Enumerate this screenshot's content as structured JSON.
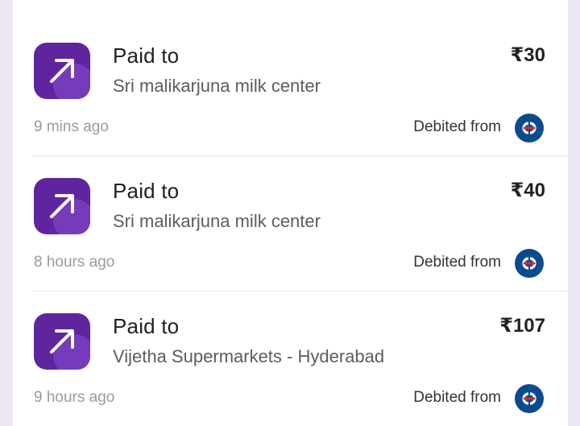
{
  "transactions": [
    {
      "title": "Paid to",
      "merchant": "Sri malikarjuna milk center",
      "amount": "₹30",
      "time": "9 mins ago",
      "debited_label": "Debited from"
    },
    {
      "title": "Paid to",
      "merchant": "Sri malikarjuna milk center",
      "amount": "₹40",
      "time": "8 hours ago",
      "debited_label": "Debited from"
    },
    {
      "title": "Paid to",
      "merchant": "Vijetha Supermarkets - Hyderabad",
      "amount": "₹107",
      "time": "9 hours ago",
      "debited_label": "Debited from"
    }
  ],
  "icons": {
    "payment": "arrow-up-right-icon",
    "bank": "bank-logo-icon"
  },
  "colors": {
    "brand": "#5f259f",
    "page_background": "#ece6f5",
    "bank_logo": "#0a4a8f"
  }
}
